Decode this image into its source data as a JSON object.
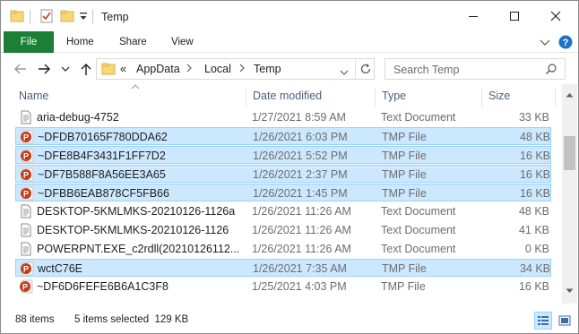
{
  "window": {
    "title": "Temp",
    "colors": {
      "file_tab": "#1b7f36",
      "selection": "#cce8ff",
      "selection_border": "#99d1ff",
      "folder": "#f8d775",
      "ppt": "#c43e1c"
    }
  },
  "ribbon": {
    "tabs": [
      "File",
      "Home",
      "Share",
      "View"
    ]
  },
  "address": {
    "overflow": "«",
    "crumbs": [
      "AppData",
      "Local",
      "Temp"
    ],
    "search_placeholder": "Search Temp"
  },
  "columns": [
    "Name",
    "Date modified",
    "Type",
    "Size"
  ],
  "files": [
    {
      "name": "aria-debug-4752",
      "date": "1/27/2021 8:59 AM",
      "type": "Text Document",
      "size": "33 KB",
      "icon": "text-file-icon",
      "selected": false
    },
    {
      "name": "~DFDB70165F780DDA62",
      "date": "1/26/2021 6:03 PM",
      "type": "TMP File",
      "size": "48 KB",
      "icon": "powerpoint-file-icon",
      "selected": true
    },
    {
      "name": "~DFE8B4F3431F1FF7D2",
      "date": "1/26/2021 5:52 PM",
      "type": "TMP File",
      "size": "16 KB",
      "icon": "powerpoint-file-icon",
      "selected": true
    },
    {
      "name": "~DF7B588F8A56EE3A65",
      "date": "1/26/2021 2:37 PM",
      "type": "TMP File",
      "size": "16 KB",
      "icon": "powerpoint-file-icon",
      "selected": true
    },
    {
      "name": "~DFBB6EAB878CF5FB66",
      "date": "1/26/2021 1:45 PM",
      "type": "TMP File",
      "size": "16 KB",
      "icon": "powerpoint-file-icon",
      "selected": true
    },
    {
      "name": "DESKTOP-5KMLMKS-20210126-1126a",
      "date": "1/26/2021 11:26 AM",
      "type": "Text Document",
      "size": "48 KB",
      "icon": "text-file-icon",
      "selected": false
    },
    {
      "name": "DESKTOP-5KMLMKS-20210126-1126",
      "date": "1/26/2021 11:26 AM",
      "type": "Text Document",
      "size": "41 KB",
      "icon": "text-file-icon",
      "selected": false
    },
    {
      "name": "POWERPNT.EXE_c2rdll(20210126112...",
      "date": "1/26/2021 11:26 AM",
      "type": "Text Document",
      "size": "0 KB",
      "icon": "text-file-icon",
      "selected": false
    },
    {
      "name": "wctC76E",
      "date": "1/26/2021 7:35 AM",
      "type": "TMP File",
      "size": "34 KB",
      "icon": "powerpoint-file-icon",
      "selected": true
    },
    {
      "name": "~DF6D6FEFE6B6A1C3F8",
      "date": "1/25/2021 4:03 PM",
      "type": "TMP File",
      "size": "16 KB",
      "icon": "powerpoint-file-icon",
      "selected": false
    }
  ],
  "status": {
    "item_count": "88 items",
    "selection": "5 items selected  129 KB"
  }
}
